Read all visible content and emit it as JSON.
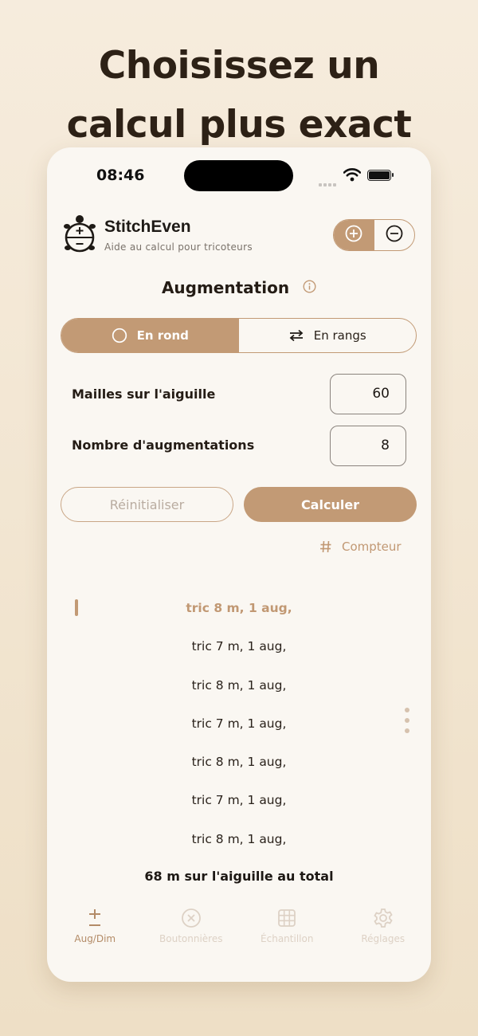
{
  "headline": {
    "line1": "Choisissez un",
    "line2": "calcul plus exact"
  },
  "status_bar": {
    "time": "08:46"
  },
  "app": {
    "name": "StitchEven",
    "subtitle": "Aide au calcul pour tricoteurs",
    "mode_toggle": {
      "increase_icon": "plus-circle-icon",
      "decrease_icon": "minus-circle-icon",
      "active": "increase"
    }
  },
  "section": {
    "title": "Augmentation",
    "info_icon": "info-icon"
  },
  "knitting_mode": {
    "options": [
      {
        "label": "En rond",
        "icon": "circle-icon",
        "active": true
      },
      {
        "label": "En rangs",
        "icon": "swap-arrows-icon",
        "active": false
      }
    ]
  },
  "fields": {
    "stitches": {
      "label": "Mailles sur l'aiguille",
      "value": "60"
    },
    "increases": {
      "label": "Nombre d'augmentations",
      "value": "8"
    }
  },
  "buttons": {
    "reset": "Réinitialiser",
    "calculate": "Calculer"
  },
  "counter": {
    "label": "Compteur",
    "icon": "hash-icon"
  },
  "steps": [
    "tric 8 m, 1 aug,",
    "tric 7 m, 1 aug,",
    "tric 8 m, 1 aug,",
    "tric 7 m, 1 aug,",
    "tric 8 m, 1 aug,",
    "tric 7 m, 1 aug,",
    "tric 8 m, 1 aug,"
  ],
  "current_step_index": 0,
  "total": "68 m sur l'aiguille au total",
  "tabbar": {
    "tabs": [
      {
        "label": "Aug/Dim",
        "icon": "plus-minus-icon",
        "active": true
      },
      {
        "label": "Boutonnières",
        "icon": "buttonhole-icon",
        "active": false
      },
      {
        "label": "Échantillon",
        "icon": "grid-icon",
        "active": false
      },
      {
        "label": "Réglages",
        "icon": "gear-icon",
        "active": false
      }
    ]
  },
  "colors": {
    "accent": "#c29a75",
    "background": "#faf7f2",
    "page_gradient_top": "#f6ecdd",
    "page_gradient_bottom": "#eedfc6"
  }
}
